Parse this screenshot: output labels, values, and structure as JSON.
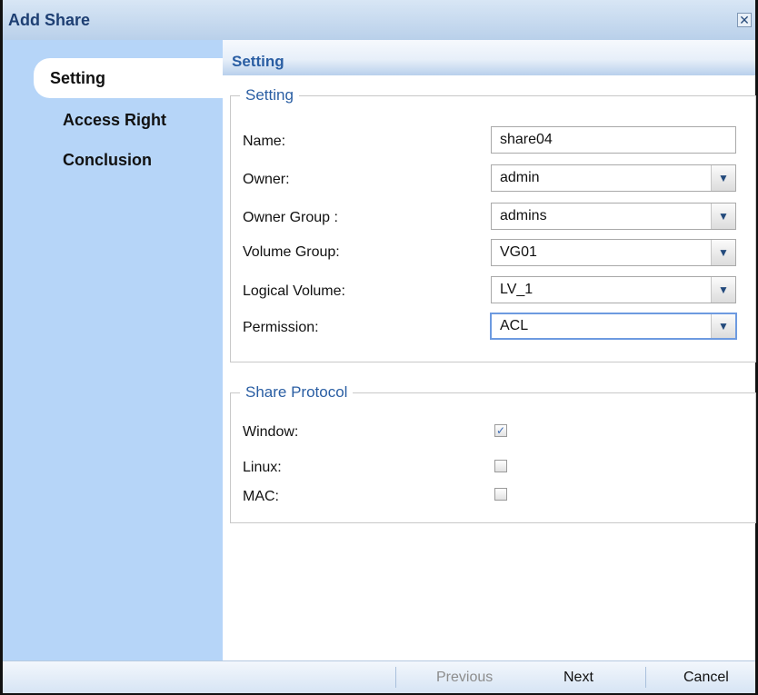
{
  "dialog": {
    "title": "Add Share",
    "close_glyph": "✕"
  },
  "sidebar": {
    "items": [
      {
        "label": "Setting",
        "active": true
      },
      {
        "label": "Access Right",
        "active": false
      },
      {
        "label": "Conclusion",
        "active": false
      }
    ]
  },
  "section_header": "Setting",
  "setting": {
    "legend": "Setting",
    "name_label": "Name:",
    "name_value": "share04",
    "owner_label": "Owner:",
    "owner_value": "admin",
    "owner_group_label": "Owner Group :",
    "owner_group_value": "admins",
    "volume_group_label": "Volume Group:",
    "volume_group_value": "VG01",
    "logical_volume_label": "Logical Volume:",
    "logical_volume_value": "LV_1",
    "permission_label": "Permission:",
    "permission_value": "ACL"
  },
  "protocol": {
    "legend": "Share Protocol",
    "window_label": "Window:",
    "window_checked": true,
    "linux_label": "Linux:",
    "linux_checked": false,
    "mac_label": "MAC:",
    "mac_checked": false
  },
  "footer": {
    "previous": "Previous",
    "next": "Next",
    "cancel": "Cancel"
  },
  "icons": {
    "dropdown": "chevron-down-icon",
    "check": "✓"
  }
}
